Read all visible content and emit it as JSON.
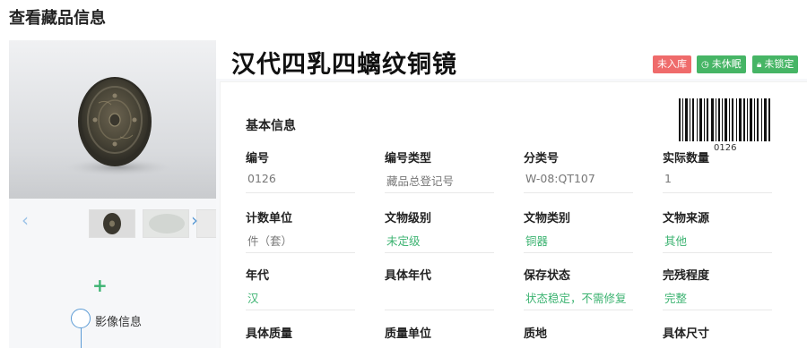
{
  "page": {
    "title": "查看藏品信息"
  },
  "relic": {
    "name": "汉代四乳四螭纹铜镜",
    "badges": {
      "storage": "未入库",
      "dormant": "未休眠",
      "locked": "未锁定"
    }
  },
  "timeline": {
    "image_info_label": "影像信息"
  },
  "info": {
    "section_title": "基本信息",
    "barcode_text": "0126",
    "fields": [
      {
        "label": "编号",
        "value": "0126"
      },
      {
        "label": "编号类型",
        "value": "藏品总登记号"
      },
      {
        "label": "分类号",
        "value": "W-08:QT107"
      },
      {
        "label": "实际数量",
        "value": "1"
      },
      {
        "label": "计数单位",
        "value": "件（套）"
      },
      {
        "label": "文物级别",
        "value": "未定级"
      },
      {
        "label": "文物类别",
        "value": "铜器"
      },
      {
        "label": "文物来源",
        "value": "其他"
      },
      {
        "label": "年代",
        "value": "汉"
      },
      {
        "label": "具体年代",
        "value": ""
      },
      {
        "label": "保存状态",
        "value": "状态稳定，不需修复"
      },
      {
        "label": "完残程度",
        "value": "完整"
      },
      {
        "label": "具体质量",
        "value": ""
      },
      {
        "label": "质量单位",
        "value": ""
      },
      {
        "label": "质地",
        "value": ""
      },
      {
        "label": "具体尺寸",
        "value": ""
      }
    ]
  },
  "colors": {
    "accent_green": "#3cb371",
    "badge_red": "#ef6b6b",
    "badge_green": "#46b565",
    "link_blue": "#5b9bd5"
  },
  "icons": {
    "prev": "chevron-left-icon",
    "next": "chevron-right-icon",
    "add": "plus-icon",
    "dormant": "clock-icon",
    "locked": "lock-icon"
  }
}
